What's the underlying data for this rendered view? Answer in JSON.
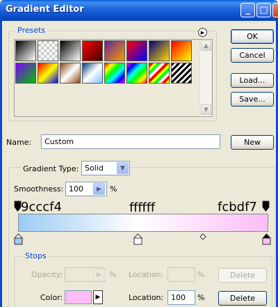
{
  "window": {
    "title": "Gradient Editor"
  },
  "title_buttons": {
    "minimize": "_",
    "maximize": "□",
    "close": "✕"
  },
  "presets": {
    "label": "Presets",
    "swatches": [
      "linear-gradient(135deg,#000,#fff)",
      "repeating-conic-gradient(#ccc 0 25%, #fff 0 50%) 0 0/8px 8px",
      "linear-gradient(135deg,#000,#fff)",
      "linear-gradient(135deg,#f00,#400)",
      "linear-gradient(135deg,#6a1fa0,#f0a000)",
      "linear-gradient(135deg,#f00,#00f)",
      "linear-gradient(135deg,#000080,#ffd700)",
      "linear-gradient(135deg,#f00,#ff0)",
      "linear-gradient(135deg,#8000ff,#00c000)",
      "linear-gradient(135deg,#f00,#ff0,#00f)",
      "linear-gradient(135deg,#8b4513,#fff,#8b4513)",
      "linear-gradient(135deg,#003a80,#fff,#80c0ff)",
      "linear-gradient(135deg,#f00,#ff0,#0f0,#0ff,#00f,#f0f)",
      "linear-gradient(135deg,#f0f,#00f,#0ff,#0f0,#ff0,#f00)",
      "repeating-linear-gradient(135deg,#f00 0 4px,#ff0 4px 8px,#0f0 8px 12px,#fff 12px 16px)",
      "repeating-linear-gradient(135deg,#000 0 3px,#fff 3px 6px)"
    ]
  },
  "buttons": {
    "ok": "OK",
    "cancel": "Cancel",
    "load": "Load...",
    "save": "Save...",
    "new": "New",
    "delete_opacity": "Delete",
    "delete_color": "Delete"
  },
  "name": {
    "label": "Name:",
    "value": "Custom"
  },
  "gradient_type": {
    "label": "Gradient Type:",
    "value": "Solid"
  },
  "smoothness": {
    "label": "Smoothness:",
    "value": "100",
    "unit": "%"
  },
  "gradient": {
    "left_color_label": "9cccf4",
    "mid_color_label": "ffffff",
    "right_color_label": "fcbdf7",
    "left_color": "#9cccf4",
    "mid_color": "#ffffff",
    "right_color": "#fcbdf7"
  },
  "stops": {
    "label": "Stops",
    "opacity_label": "Opacity:",
    "opacity_value": "",
    "opacity_unit": "%",
    "opacity_location_label": "Location:",
    "opacity_location_value": "",
    "opacity_location_unit": "%",
    "color_label": "Color:",
    "color_value": "#fcbdf7",
    "color_location_label": "Location:",
    "color_location_value": "100",
    "color_location_unit": "%"
  }
}
